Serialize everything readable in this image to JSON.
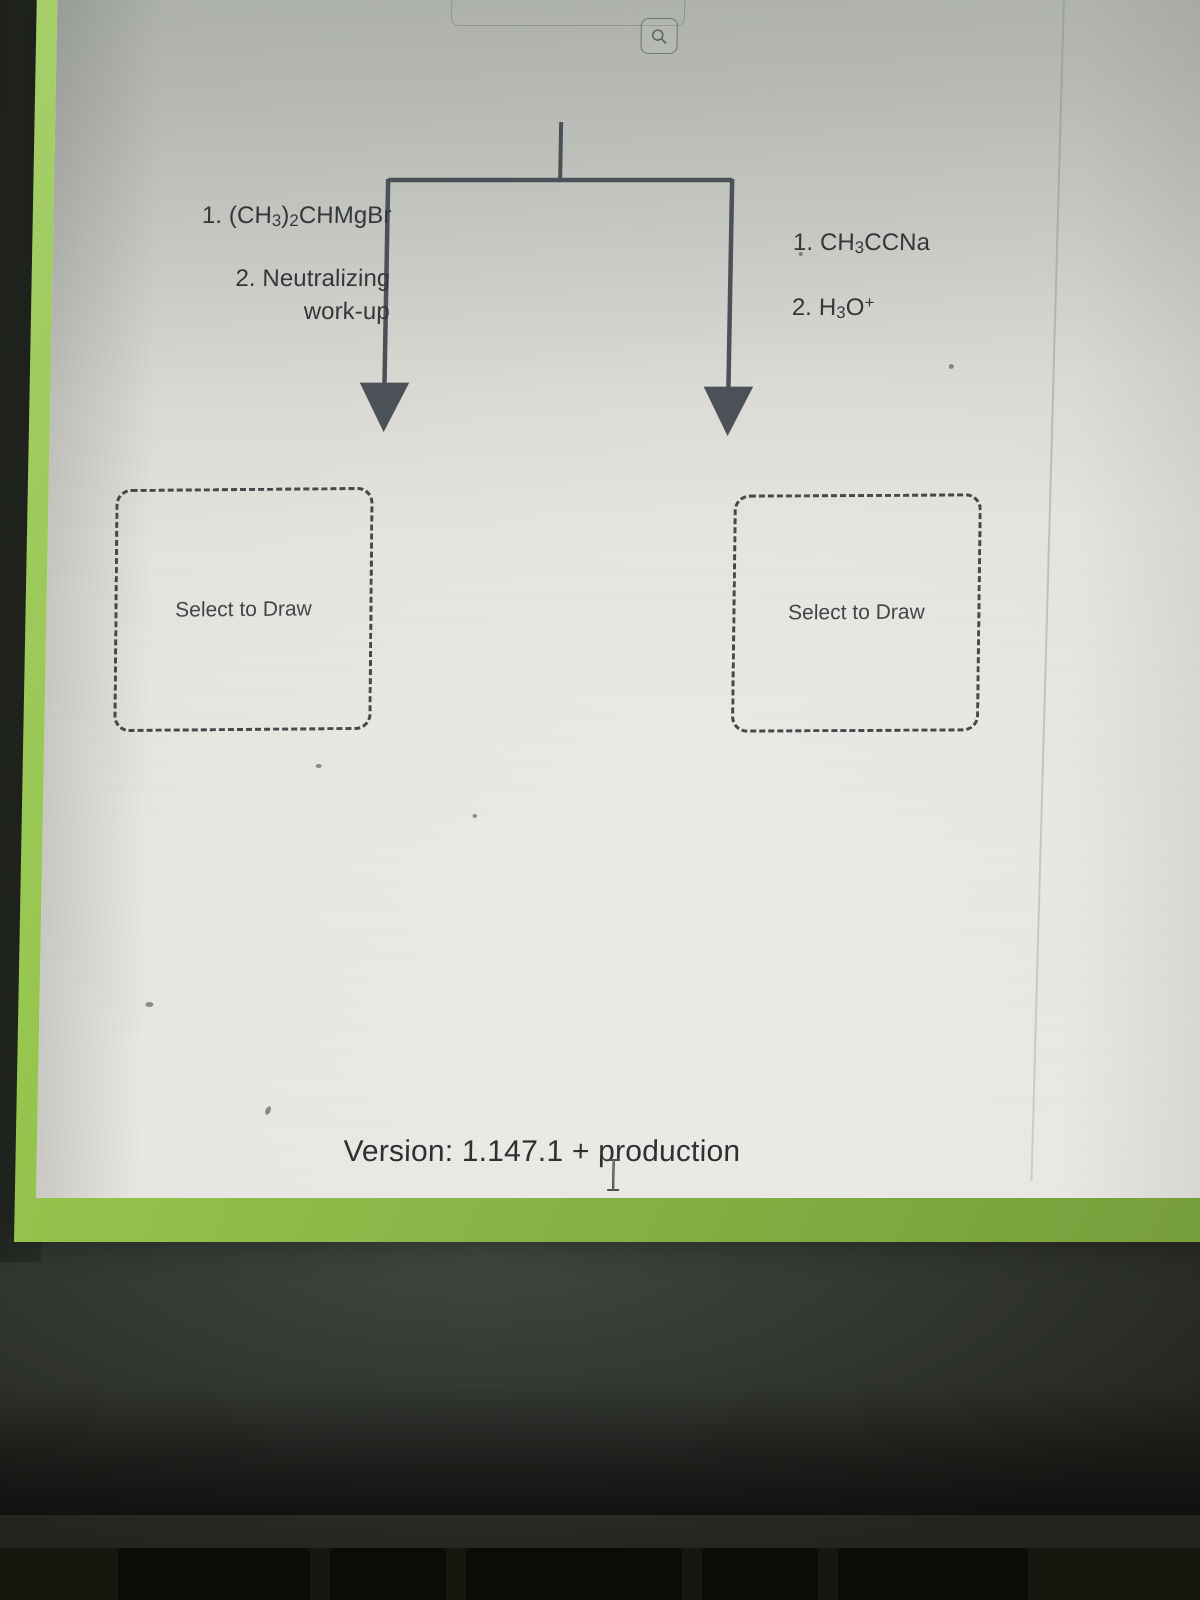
{
  "app": {
    "surface": "chemistry-reaction-drawing-exercise",
    "screen_bg": "#e9e7e1",
    "bezel_color": "#93c44a",
    "ink_color": "#33373a"
  },
  "toolbar": {
    "zoom_button": {
      "icon": "magnifying-glass-icon",
      "label": ""
    }
  },
  "reaction": {
    "branch_count": 2,
    "left_branch": {
      "reagents": [
        {
          "index": "1.",
          "formula_html": "(CH<sub>3</sub>)<sub>2</sub>CHMgBr",
          "plain": "1. (CH3)2CHMgBr"
        },
        {
          "index": "2.",
          "line_a": "Neutralizing",
          "line_b": "work-up",
          "plain": "2. Neutralizing work-up"
        }
      ],
      "product_placeholder": "Select to Draw"
    },
    "right_branch": {
      "reagents": [
        {
          "index": "1.",
          "formula_html": "CH<sub>3</sub>CCNa",
          "plain": "1. CH3CCNa"
        },
        {
          "index": "2.",
          "formula_html": "H<sub>3</sub>O<sup>+</sup>",
          "plain": "2. H3O+"
        }
      ],
      "product_placeholder": "Select to Draw"
    }
  },
  "footer": {
    "version_text": "Version: 1.147.1 + production",
    "version_number": "1.147.1",
    "environment": "production"
  },
  "cursor": {
    "type": "text-ibeam"
  }
}
